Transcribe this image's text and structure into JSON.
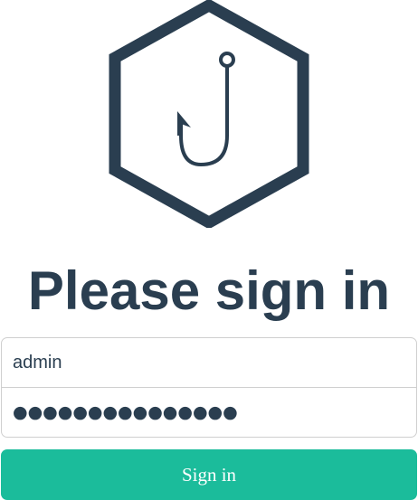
{
  "logo": {
    "icon": "hexagon-fishhook-logo",
    "color": "#2a3e50"
  },
  "heading": "Please sign in",
  "form": {
    "username_value": "admin",
    "password_masked": "●●●●●●●●●●●●●●●",
    "submit_label": "Sign in"
  },
  "colors": {
    "text": "#2a3e50",
    "accent": "#1bbc9b",
    "border": "#cfcfcf"
  }
}
